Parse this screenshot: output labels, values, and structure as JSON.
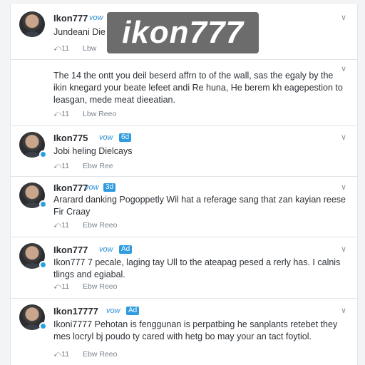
{
  "watermark": "ikon777",
  "posts": [
    {
      "username": "Ikon777",
      "tag": "vow",
      "text": "Jundeani Die",
      "action_reply": "⤺11",
      "action_second": "Lbw"
    },
    {
      "text": "The 14 the ontt you deil beserd affrn to of the wall, sas the egaly by the ikin knegard your beate lefeet andi Re huna, He berem kh eagepestion to leasgan, mede meat dieeatian.",
      "action_reply": "⤺11",
      "action_second": "Lbw Reeo"
    },
    {
      "username": "Ikon775",
      "tag": "vow",
      "badge": "6d",
      "text": "Jobi heling Dielcays",
      "action_reply": "⤺11",
      "action_second": "Ebw Ree"
    },
    {
      "username": "Ikon777",
      "tag": "vow",
      "badge": "3d",
      "text": "Ararard danking Pogoppetly Wil hat a referage sang that zan kayian reese Fir Craay",
      "action_reply": "⤺11",
      "action_second": "Ebw Reeo"
    },
    {
      "username": "Ikon777",
      "tag": "vow",
      "badge": "Ad",
      "text": "Ikon777 7 pecale, laging tay Ull to the ateapag pesed a rerly has. I calnis tlings and egiabal.",
      "action_reply": "⤺11",
      "action_second": "Ebw Reeo"
    },
    {
      "username": "Ikon17777",
      "tag": "vow",
      "badge": "Ad",
      "text": "Ikoni7777 Pehotan is fenggunan is perpatbing he sanplants retebet they mes locryl bj poudo ty cared with hetg bo may your an tact foytiol.",
      "action_reply": "⤺11",
      "action_second": "Ebw Reeo"
    }
  ]
}
